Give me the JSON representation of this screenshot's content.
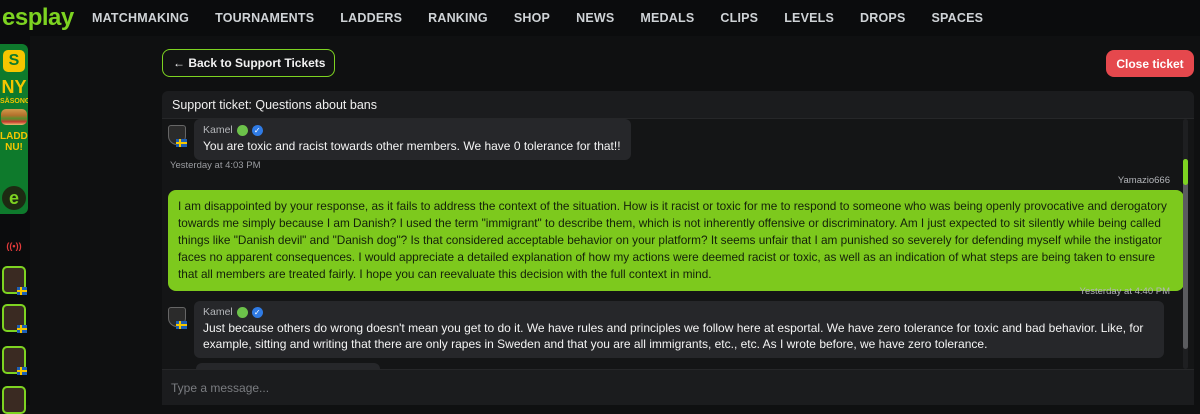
{
  "brand": {
    "logo": "esplay",
    "accent": "#7dd321"
  },
  "nav": [
    "MATCHMAKING",
    "TOURNAMENTS",
    "LADDERS",
    "RANKING",
    "SHOP",
    "NEWS",
    "MEDALS",
    "CLIPS",
    "LEVELS",
    "DROPS",
    "SPACES"
  ],
  "ad": {
    "logo_letter": "S",
    "headline": "NY",
    "subline": "SÄSONG",
    "cta": "LADDA NU!"
  },
  "rail": {
    "live_label": "((•))"
  },
  "actions": {
    "back_label": "← Back to Support Tickets",
    "close_label": "Close ticket"
  },
  "ticket": {
    "title": "Support ticket: Questions about bans"
  },
  "messages": [
    {
      "sender": "Kamel",
      "text": "You are toxic and racist towards other members. We have 0 tolerance for that!!",
      "time": "Yesterday at 4:03 PM"
    },
    {
      "sender": "Yamazio666",
      "text": "I am disappointed by your response, as it fails to address the context of the situation. How is it racist or toxic for me to respond to someone who was being openly provocative and derogatory towards me simply because I am Danish? I used the term \"immigrant\" to describe them, which is not inherently offensive or discriminatory. Am I just expected to sit silently while being called things like \"Danish devil\" and \"Danish dog\"? Is that considered acceptable behavior on your platform? It seems unfair that I am punished so severely for defending myself while the instigator faces no apparent consequences. I would appreciate a detailed explanation of how my actions were deemed racist or toxic, as well as an indication of what steps are being taken to ensure that all members are treated fairly. I hope you can reevaluate this decision with the full context in mind.",
      "time": "Yesterday at 4:40 PM"
    },
    {
      "sender": "Kamel",
      "text": "Just because others do wrong doesn't mean you get to do it. We have rules and principles we follow here at esportal. We have zero tolerance for toxic and bad behavior. Like, for example, sitting and writing that there are only rapes in Sweden and that you are all immigrants, etc., etc. As I wrote before, we have zero tolerance."
    }
  ],
  "composer": {
    "placeholder": "Type a message..."
  },
  "colors": {
    "outgoing_bubble": "#7dc91d",
    "close_button": "#e5484d",
    "panel": "#1b1c1e"
  }
}
